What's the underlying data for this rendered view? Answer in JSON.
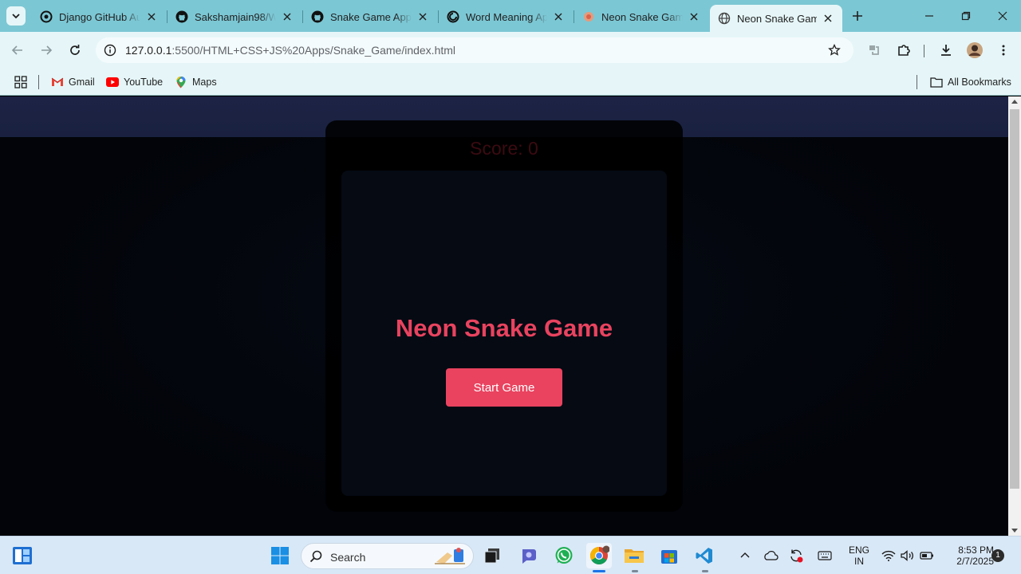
{
  "browser": {
    "tabs": [
      {
        "title": "Django GitHub Au",
        "icon": "openai-icon"
      },
      {
        "title": "Sakshamjain98/W",
        "icon": "github-icon"
      },
      {
        "title": "Snake Game App -",
        "icon": "github-icon"
      },
      {
        "title": "Word Meaning Ap",
        "icon": "github-copilot-icon"
      },
      {
        "title": "Neon Snake Game",
        "icon": "snake-icon"
      },
      {
        "title": "Neon Snake Game",
        "icon": "globe-icon",
        "active": true
      }
    ],
    "address_bar": {
      "host": "127.0.0.1",
      "rest": ":5500/HTML+CSS+JS%20Apps/Snake_Game/index.html"
    },
    "bookmarks": [
      {
        "label": "Gmail",
        "icon": "gmail-icon"
      },
      {
        "label": "YouTube",
        "icon": "youtube-icon"
      },
      {
        "label": "Maps",
        "icon": "maps-icon"
      }
    ],
    "all_bookmarks_label": "All Bookmarks"
  },
  "page": {
    "score_text": "Score: 0",
    "game_title": "Neon Snake Game",
    "start_button": "Start Game"
  },
  "taskbar": {
    "search_placeholder": "Search",
    "language_line1": "ENG",
    "language_line2": "IN",
    "time": "8:53 PM",
    "date": "2/7/2025",
    "notification_count": "1"
  },
  "colors": {
    "accent": "#e9435f",
    "chrome": "#7cc7d4",
    "toolbar": "#e6f6f8"
  }
}
